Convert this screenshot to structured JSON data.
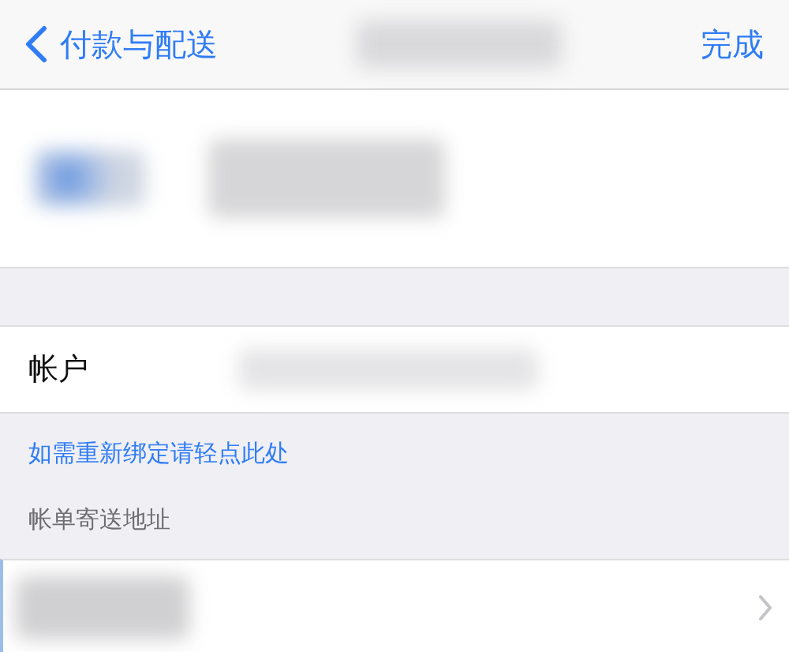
{
  "nav": {
    "back_label": "付款与配送",
    "done_label": "完成"
  },
  "account": {
    "label": "帐户"
  },
  "rebind_link": "如需重新绑定请轻点此处",
  "billing_header": "帐单寄送地址"
}
